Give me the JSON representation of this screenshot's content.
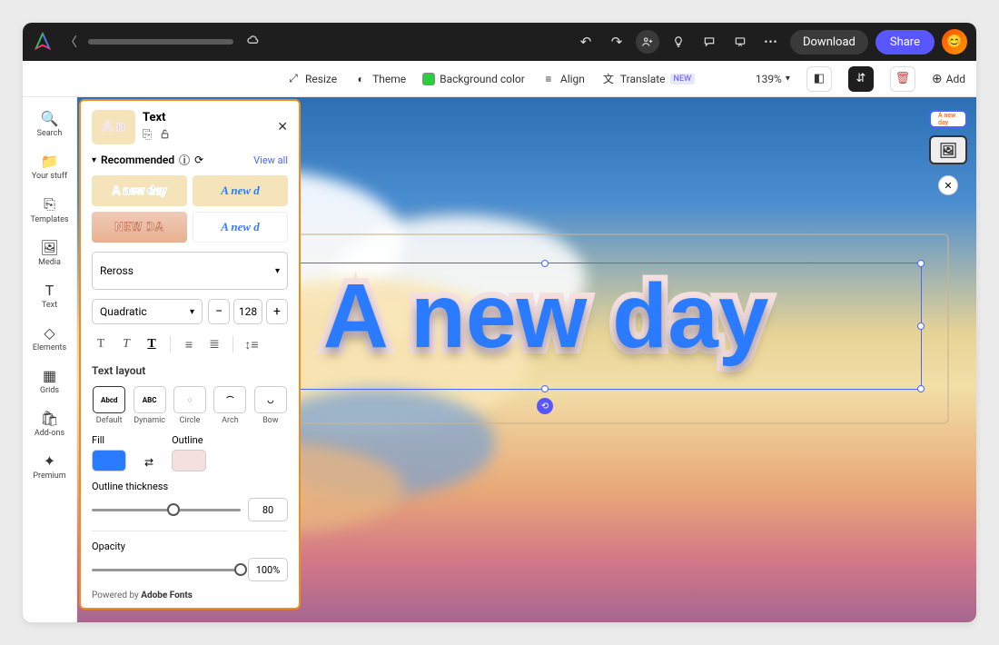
{
  "header": {
    "download": "Download",
    "share": "Share"
  },
  "toolbar": {
    "resize": "Resize",
    "theme": "Theme",
    "bgcolor": "Background color",
    "align": "Align",
    "translate": "Translate",
    "translate_badge": "NEW",
    "zoom": "139%",
    "add": "Add"
  },
  "leftbar": {
    "items": [
      {
        "icon": "🔍",
        "label": "Search"
      },
      {
        "icon": "📁",
        "label": "Your stuff"
      },
      {
        "icon": "⎘",
        "label": "Templates"
      },
      {
        "icon": "🖼",
        "label": "Media"
      },
      {
        "icon": "T",
        "label": "Text"
      },
      {
        "icon": "◇",
        "label": "Elements"
      },
      {
        "icon": "▦",
        "label": "Grids"
      },
      {
        "icon": "🛍",
        "label": "Add-ons"
      },
      {
        "icon": "✦",
        "label": "Premium"
      }
    ]
  },
  "panel": {
    "title": "Text",
    "thumb_text": "A n",
    "recommended": "Recommended",
    "viewall": "View all",
    "rec_samples": [
      "A new day",
      "A new d",
      "NEW  DA",
      "A new d"
    ],
    "font_family": "Reross",
    "font_style": "Quadratic",
    "font_size": "128",
    "text_layout_label": "Text layout",
    "layouts": [
      {
        "icon": "Abcd",
        "label": "Default"
      },
      {
        "icon": "ABC",
        "label": "Dynamic"
      },
      {
        "icon": "◌",
        "label": "Circle"
      },
      {
        "icon": "⌒",
        "label": "Arch"
      },
      {
        "icon": "◡",
        "label": "Bow"
      }
    ],
    "fill_label": "Fill",
    "outline_label": "Outline",
    "outline_thickness_label": "Outline thickness",
    "outline_thickness_value": "80",
    "opacity_label": "Opacity",
    "opacity_value": "100%",
    "footer_prefix": "Powered by ",
    "footer_brand": "Adobe Fonts"
  },
  "canvas": {
    "main_text": "A new day",
    "thumb_text": "A new day"
  }
}
